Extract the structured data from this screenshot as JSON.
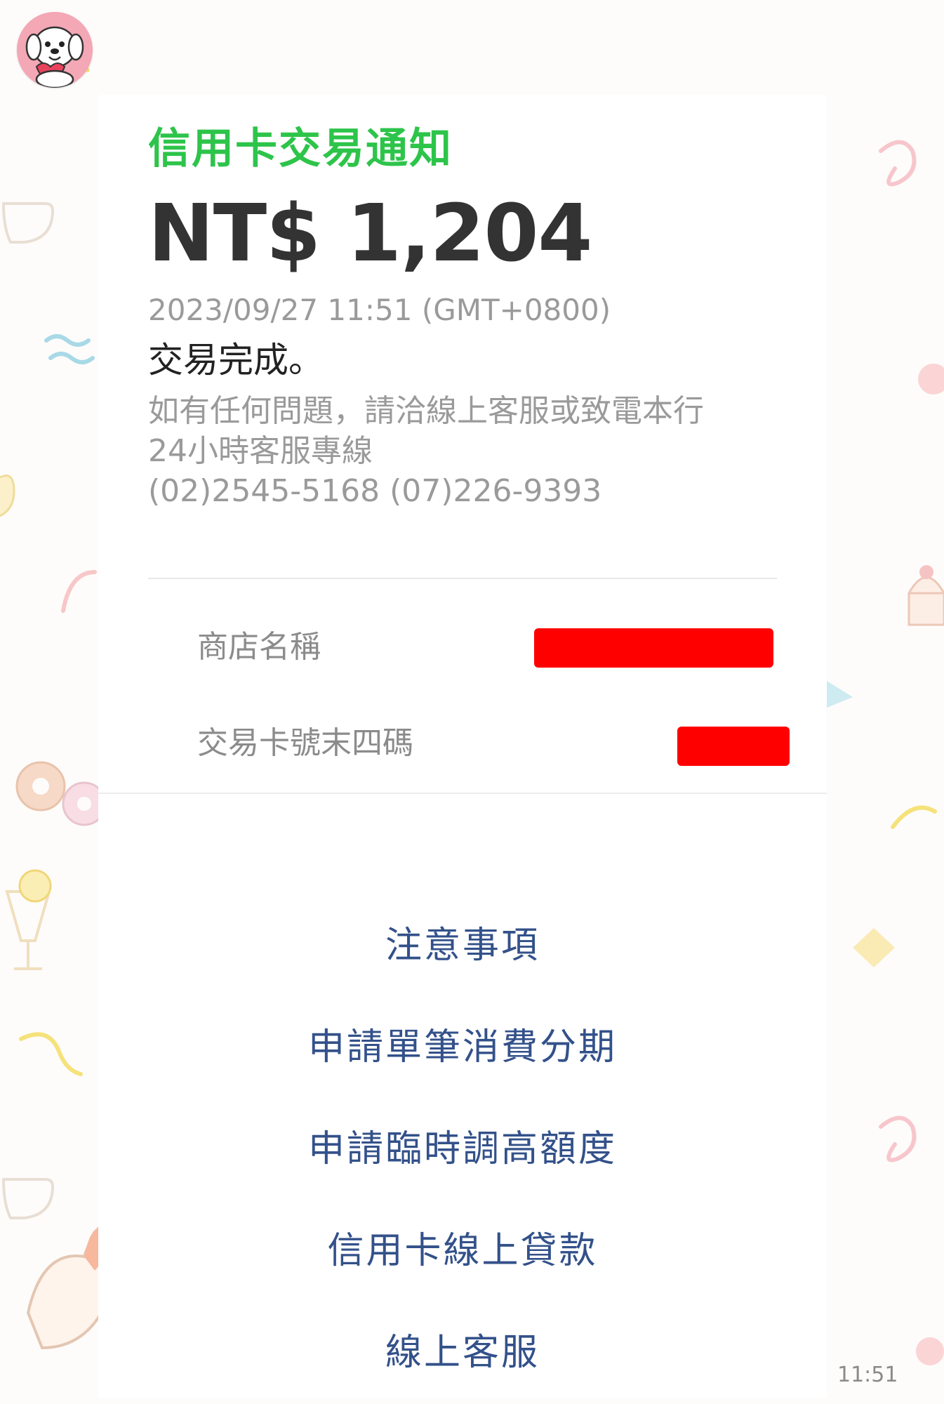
{
  "message": {
    "title": "信用卡交易通知",
    "amount": "NT$ 1,204",
    "datetime": "2023/09/27 11:51 (GMT+0800)",
    "status": "交易完成。",
    "notice_line1": "如有任何問題，請洽線上客服或致電本行",
    "notice_line2": "24小時客服專線",
    "notice_line3": "(02)2545-5168 (07)226-9393"
  },
  "details": {
    "store_label": "商店名稱",
    "card_label": "交易卡號末四碼"
  },
  "actions": [
    {
      "label": "注意事項"
    },
    {
      "label": "申請單筆消費分期"
    },
    {
      "label": "申請臨時調高額度"
    },
    {
      "label": "信用卡線上貸款"
    },
    {
      "label": "線上客服"
    }
  ],
  "sent_time": "11:51",
  "colors": {
    "title": "#2dc44a",
    "action_link": "#33518a",
    "redaction": "#ff0000"
  },
  "icons": {
    "avatar": "puppy-avatar-icon"
  }
}
